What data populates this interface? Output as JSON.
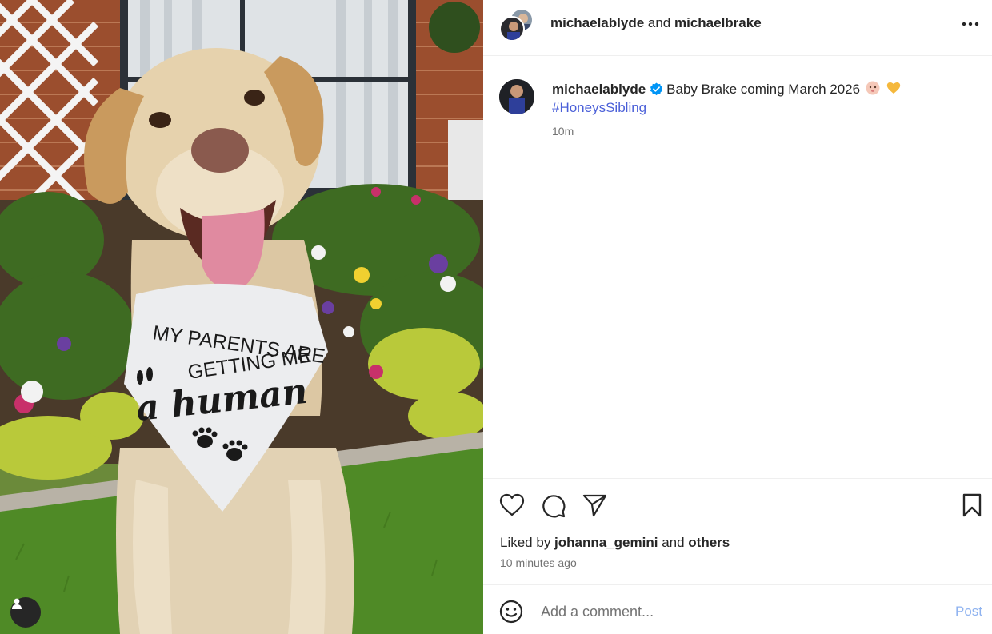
{
  "post": {
    "photo": {
      "bandana_text": "MY PARENTS ARE GETTING ME a human",
      "tag_icon": "person-tag-icon"
    },
    "header": {
      "user_1": "michaelablyde",
      "joiner": " and ",
      "user_2": "michaelbrake",
      "more_icon": "more-horizontal-icon"
    },
    "caption": {
      "username": "michaelablyde",
      "verified_icon": "verified-badge-icon",
      "text": "Baby Brake coming March 2026",
      "emojis": [
        "baby-emoji",
        "yellow-heart-emoji"
      ],
      "hashtag": "#HoneysSibling",
      "time": "10m"
    },
    "actions": {
      "like_icon": "heart-icon",
      "comment_icon": "comment-icon",
      "share_icon": "send-icon",
      "save_icon": "bookmark-icon"
    },
    "likes": {
      "prefix": "Liked by ",
      "user": "johanna_gemini",
      "joiner": " and ",
      "others": "others"
    },
    "post_time": "10 minutes ago",
    "comment": {
      "placeholder": "Add a comment...",
      "post_label": "Post",
      "emoji_icon": "smiley-icon"
    },
    "colors": {
      "link": "#4a5fd8",
      "verified": "#0095f6",
      "post_button": "#8fb3f0",
      "secondary_text": "#737373"
    }
  }
}
